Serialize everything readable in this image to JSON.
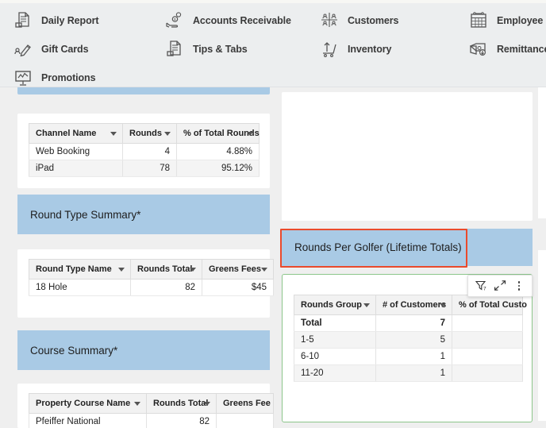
{
  "ribbon": {
    "columns": [
      {
        "items": [
          {
            "label": "Daily Report",
            "icon": "daily-report-icon"
          },
          {
            "label": "Gift Cards",
            "icon": "gift-cards-icon"
          },
          {
            "label": "Promotions",
            "icon": "promotions-icon"
          }
        ]
      },
      {
        "items": [
          {
            "label": "Accounts Receivable",
            "icon": "accounts-receivable-icon"
          },
          {
            "label": "Tips & Tabs",
            "icon": "tips-tabs-icon"
          }
        ]
      },
      {
        "items": [
          {
            "label": "Customers",
            "icon": "customers-icon"
          },
          {
            "label": "Inventory",
            "icon": "inventory-icon"
          }
        ]
      },
      {
        "items": [
          {
            "label": "Employee C",
            "icon": "employee-clock-icon"
          },
          {
            "label": "Remittance",
            "icon": "remittance-icon"
          }
        ]
      }
    ]
  },
  "left_column": {
    "channel_table": {
      "headers": [
        "Channel Name",
        "Rounds",
        "% of Total Rounds"
      ],
      "rows": [
        {
          "name": "Web Booking",
          "rounds": "4",
          "pct": "4.88%"
        },
        {
          "name": "iPad",
          "rounds": "78",
          "pct": "95.12%"
        }
      ]
    },
    "round_type_section": {
      "title": "Round Type Summary*"
    },
    "round_type_table": {
      "headers": [
        "Round Type Name",
        "Rounds Total",
        "Greens Fees"
      ],
      "rows": [
        {
          "name": "18 Hole",
          "rounds_total": "82",
          "greens_fees": "$45"
        }
      ]
    },
    "course_section": {
      "title": "Course Summary*"
    },
    "course_table": {
      "headers": [
        "Property Course Name",
        "Rounds Total",
        "Greens Fee"
      ],
      "rows": [
        {
          "name": "Pfeiffer National",
          "rounds_total": "82",
          "greens_fees": ""
        }
      ]
    }
  },
  "right_column": {
    "rounds_per_golfer_section": {
      "title": "Rounds Per Golfer (Lifetime Totals)"
    },
    "rounds_per_golfer_table": {
      "headers": [
        "Rounds Group",
        "# of Customers",
        "% of Total Custo"
      ],
      "rows": [
        {
          "group": "Total",
          "customers": "7",
          "pct": "",
          "bold": true
        },
        {
          "group": "1-5",
          "customers": "5",
          "pct": "",
          "bold": false
        },
        {
          "group": "6-10",
          "customers": "1",
          "pct": "",
          "bold": false
        },
        {
          "group": "11-20",
          "customers": "1",
          "pct": "",
          "bold": false
        }
      ]
    },
    "viz_toolbar": {
      "filter_label": "7",
      "filter_icon": "filter-icon",
      "focus_icon": "focus-mode-icon",
      "more_icon": "more-options-icon"
    }
  },
  "colors": {
    "section_header_blue": "#a9cae5",
    "highlight_red": "#ea4a2c",
    "highlight_green": "#8cc68b",
    "ribbon_bg": "#eceeef",
    "page_bg": "#efefef"
  }
}
